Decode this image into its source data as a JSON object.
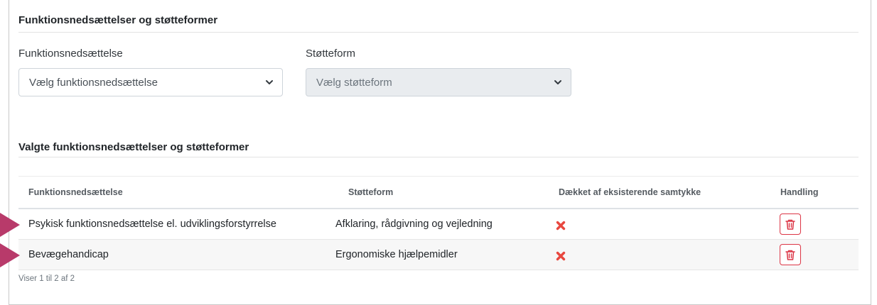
{
  "form": {
    "title": "Funktionsnedsættelser og støtteformer",
    "disability_label": "Funktionsnedsættelse",
    "disability_select_value": "Vælg funktionsnedsættelse",
    "support_label": "Støtteform",
    "support_select_value": "Vælg støtteform",
    "support_select_disabled": true
  },
  "selected": {
    "title": "Valgte funktionsnedsættelser og støtteformer",
    "columns": [
      "Funktionsnedsættelse",
      "Støtteform",
      "Dækket af eksisterende samtykke",
      "Handling"
    ],
    "rows": [
      {
        "disability": "Psykisk funktionsnedsættelse el. udviklingsforstyrrelse",
        "support": "Afklaring, rådgivning og vejledning",
        "covered_icon": "red-x-icon",
        "action_icon": "trash-icon"
      },
      {
        "disability": "Bevægehandicap",
        "support": "Ergonomiske hjælpemidler",
        "covered_icon": "red-x-icon",
        "action_icon": "trash-icon"
      }
    ],
    "info": "Viser 1 til 2 af 2"
  },
  "colors": {
    "delete": "#dc3545",
    "x_mark": "#e8473f",
    "annotation_arrow": "#b83a6a"
  }
}
